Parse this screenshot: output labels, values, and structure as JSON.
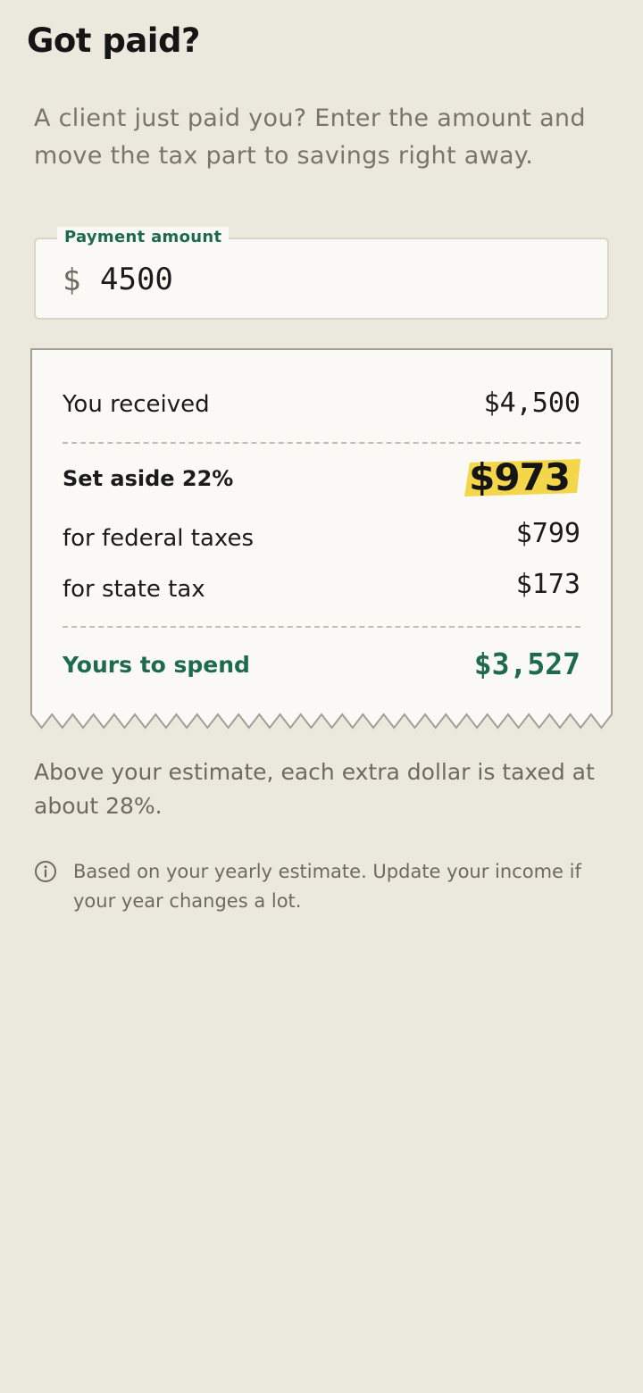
{
  "header": {
    "title": "Got paid?"
  },
  "intro": {
    "text": "A client just paid you? Enter the amount and move the tax part to savings right away."
  },
  "payment_field": {
    "label": "Payment amount",
    "currency": "$",
    "value": "4500"
  },
  "receipt": {
    "received_label": "You received",
    "received_value": "$4,500",
    "set_aside_label": "Set aside 22%",
    "set_aside_value": "$973",
    "federal_label": "for federal taxes",
    "federal_value": "$799",
    "state_label": "for state tax",
    "state_value": "$173",
    "spend_label": "Yours to spend",
    "spend_value": "$3,527"
  },
  "note": {
    "text": "Above your estimate, each extra dollar is taxed at about 28%."
  },
  "info": {
    "icon": "info-icon",
    "text": "Based on your yearly estimate. Update your income if your year changes a lot."
  },
  "colors": {
    "background": "#ebe8de",
    "accent_green": "#1d6b4c",
    "highlight_yellow": "#f3d64a",
    "receipt_paper": "#faf9f5"
  }
}
